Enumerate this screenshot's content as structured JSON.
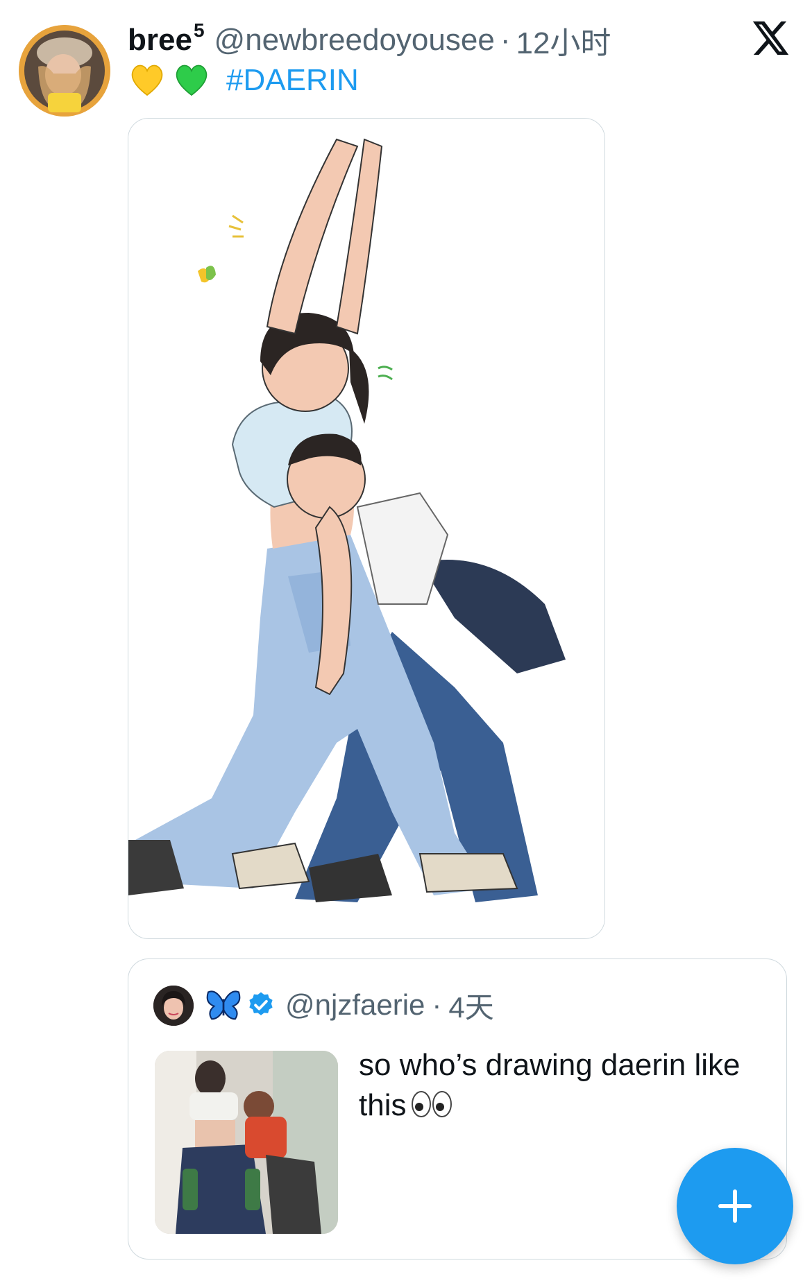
{
  "tweet": {
    "author": {
      "display_name": "bree",
      "name_superscript": "5",
      "handle": "@newbreedoyousee",
      "avatar_icon": "avatar-photo"
    },
    "time_separator": "·",
    "time": "12小时",
    "emojis": [
      "yellow-heart-icon",
      "green-heart-icon"
    ],
    "hashtag": "#DAERIN",
    "media": {
      "icon": "illustration-image"
    }
  },
  "quote": {
    "author": {
      "avatar_icon": "avatar-photo",
      "emoji": "butterfly-icon",
      "verified_icon": "verified-badge-icon",
      "handle": "@njzfaerie"
    },
    "time_separator": "·",
    "time": "4天",
    "text": "so who’s drawing daerin like this",
    "text_emoji": "eyes-icon",
    "thumbnail_icon": "photo-thumbnail"
  },
  "brand": {
    "logo": "x-logo"
  },
  "fab": {
    "icon": "plus-icon",
    "label": "compose"
  },
  "colors": {
    "accent": "#1d9bf0",
    "secondary_text": "#536471",
    "border": "#cfd9de"
  }
}
